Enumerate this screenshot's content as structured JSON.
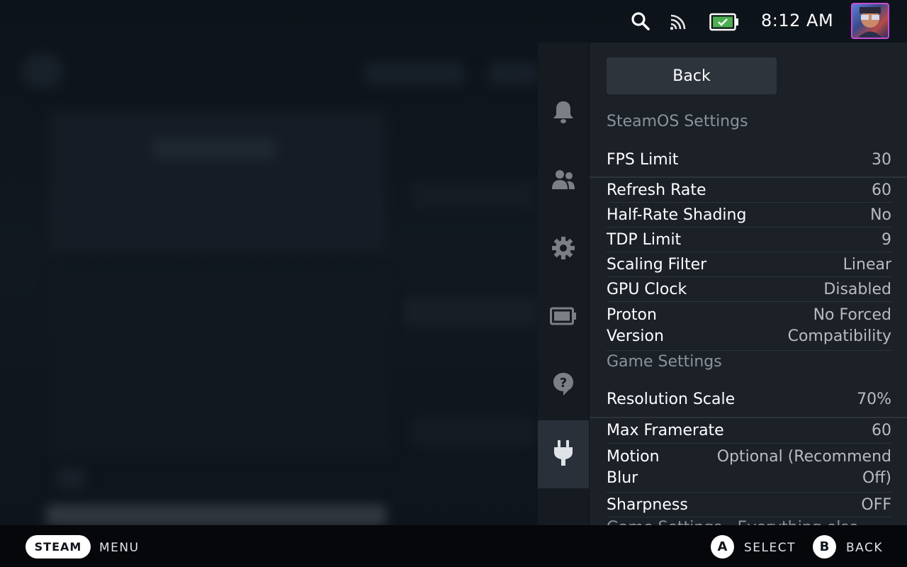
{
  "status_bar": {
    "time": "8:12 AM",
    "icons": [
      "search-icon",
      "wifi-icon",
      "battery-icon",
      "user-avatar"
    ],
    "battery_color": "#4caf50"
  },
  "quick_access": {
    "rail": [
      "bell-icon",
      "friends-icon",
      "gear-icon",
      "battery-icon",
      "help-icon",
      "plug-icon"
    ],
    "active_rail": "plug-icon",
    "back_label": "Back",
    "steamos_section": "SteamOS Settings",
    "steamos_rows": [
      {
        "label": "FPS Limit",
        "value": "30"
      },
      {
        "label": "Refresh Rate",
        "value": "60"
      },
      {
        "label": "Half-Rate Shading",
        "value": "No"
      },
      {
        "label": "TDP Limit",
        "value": "9"
      },
      {
        "label": "Scaling Filter",
        "value": "Linear"
      },
      {
        "label": "GPU Clock",
        "value": "Disabled"
      },
      {
        "label_line1": "Proton",
        "label_line2": "Version",
        "value_line1": "No Forced",
        "value_line2": "Compatibility"
      }
    ],
    "game_section": "Game Settings",
    "game_rows": [
      {
        "label": "Resolution Scale",
        "value": "70%"
      },
      {
        "label": "Max Framerate",
        "value": "60"
      },
      {
        "label_line1": "Motion",
        "label_line2": "Blur",
        "value_line1": "Optional (Recommend",
        "value_line2": "Off)"
      },
      {
        "label": "Sharpness",
        "value": "OFF"
      }
    ],
    "cutoff_text": "Game Settings - Everything else"
  },
  "bottom_bar": {
    "steam_label": "STEAM",
    "menu_label": "MENU",
    "a_glyph": "A",
    "select_label": "SELECT",
    "b_glyph": "B",
    "back_label": "BACK"
  }
}
